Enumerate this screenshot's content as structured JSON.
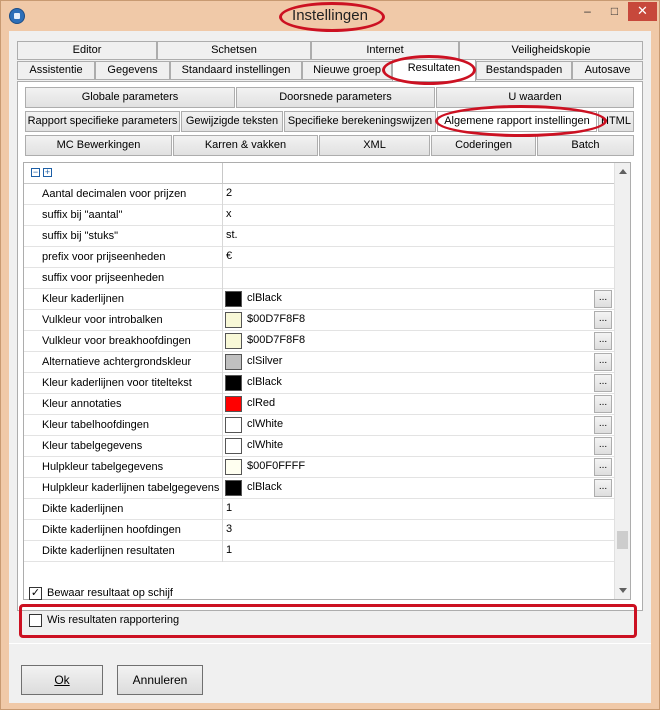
{
  "window": {
    "title": "Instellingen",
    "minimize": "–",
    "maximize": "□",
    "close": "✕"
  },
  "tabs_row1": [
    "Editor",
    "Schetsen",
    "Internet",
    "Veiligheidskopie"
  ],
  "tabs_row2": [
    "Assistentie",
    "Gegevens",
    "Standaard instellingen",
    "Nieuwe groep",
    "Resultaten",
    "Bestandspaden",
    "Autosave"
  ],
  "subtabs_row1": [
    "Globale parameters",
    "Doorsnede parameters",
    "U waarden"
  ],
  "subtabs_row2": [
    "Rapport specifieke parameters",
    "Gewijzigde teksten",
    "Specifieke berekeningswijzen",
    "Algemene rapport instellingen",
    "HTML"
  ],
  "subtabs_row3": [
    "MC Bewerkingen",
    "Karren & vakken",
    "XML",
    "Coderingen",
    "Batch"
  ],
  "grid": {
    "collapse_glyph": "−",
    "expand_glyph": "+",
    "ellipsis": "...",
    "rows": [
      {
        "name": "Aantal decimalen voor prijzen",
        "value": "2"
      },
      {
        "name": "suffix bij \"aantal\"",
        "value": "x"
      },
      {
        "name": "suffix bij \"stuks\"",
        "value": "st."
      },
      {
        "name": "prefix voor prijseenheden",
        "value": "€"
      },
      {
        "name": "suffix voor prijseenheden",
        "value": ""
      },
      {
        "name": "Kleur kaderlijnen",
        "value": "clBlack",
        "color": "#000000"
      },
      {
        "name": "Vulkleur voor introbalken",
        "value": "$00D7F8F8",
        "color": "#F8F8D7"
      },
      {
        "name": "Vulkleur voor breakhoofdingen",
        "value": "$00D7F8F8",
        "color": "#F8F8D7"
      },
      {
        "name": "Alternatieve achtergrondskleur",
        "value": "clSilver",
        "color": "#C0C0C0"
      },
      {
        "name": "Kleur kaderlijnen voor titeltekst",
        "value": "clBlack",
        "color": "#000000"
      },
      {
        "name": "Kleur annotaties",
        "value": "clRed",
        "color": "#FF0000"
      },
      {
        "name": "Kleur tabelhoofdingen",
        "value": "clWhite",
        "color": "#FFFFFF"
      },
      {
        "name": "Kleur tabelgegevens",
        "value": "clWhite",
        "color": "#FFFFFF"
      },
      {
        "name": "Hulpkleur tabelgegevens",
        "value": "$00F0FFFF",
        "color": "#FFFFF0"
      },
      {
        "name": "Hulpkleur kaderlijnen tabelgegevens",
        "value": "clBlack",
        "color": "#000000"
      },
      {
        "name": "Dikte kaderlijnen",
        "value": "1"
      },
      {
        "name": "Dikte kaderlijnen hoofdingen",
        "value": "3"
      },
      {
        "name": "Dikte kaderlijnen resultaten",
        "value": "1"
      }
    ]
  },
  "options": {
    "save_results": {
      "label": "Bewaar resultaat op schijf",
      "checked": true,
      "mark": "✓"
    },
    "clear_results": {
      "label": "Wis resultaten rapportering",
      "checked": false,
      "mark": ""
    }
  },
  "buttons": {
    "ok": "Ok",
    "cancel": "Annuleren"
  },
  "colors": {
    "annotation": "#cc1122",
    "frame": "#f0c9a8",
    "close_button": "#c7483b"
  }
}
